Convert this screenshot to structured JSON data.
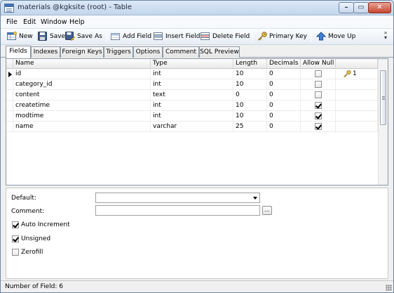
{
  "window": {
    "title": "materials @kgksite (root) - Table",
    "controls": {
      "minimize": "–",
      "maximize": "▭",
      "close": "✕"
    }
  },
  "menu": [
    "File",
    "Edit",
    "Window",
    "Help"
  ],
  "toolbar": {
    "new": "New",
    "save": "Save",
    "save_as": "Save As",
    "add_field": "Add Field",
    "insert_field": "Insert Field",
    "delete_field": "Delete Field",
    "primary_key": "Primary Key",
    "move_up": "Move Up",
    "overflow": "»"
  },
  "tabs": [
    "Fields",
    "Indexes",
    "Foreign Keys",
    "Triggers",
    "Options",
    "Comment",
    "SQL Preview"
  ],
  "active_tab": "Fields",
  "grid": {
    "columns": [
      "Name",
      "Type",
      "Length",
      "Decimals",
      "Allow Null",
      ""
    ],
    "rows": [
      {
        "name": "id",
        "type": "int",
        "length": "10",
        "decimals": "0",
        "allow_null": false,
        "key": "1",
        "current": true
      },
      {
        "name": "category_id",
        "type": "int",
        "length": "10",
        "decimals": "0",
        "allow_null": false,
        "key": "",
        "current": false
      },
      {
        "name": "content",
        "type": "text",
        "length": "0",
        "decimals": "0",
        "allow_null": false,
        "key": "",
        "current": false
      },
      {
        "name": "createtime",
        "type": "int",
        "length": "10",
        "decimals": "0",
        "allow_null": true,
        "key": "",
        "current": false
      },
      {
        "name": "modtime",
        "type": "int",
        "length": "10",
        "decimals": "0",
        "allow_null": true,
        "key": "",
        "current": false
      },
      {
        "name": "name",
        "type": "varchar",
        "length": "25",
        "decimals": "0",
        "allow_null": true,
        "key": "",
        "current": false
      }
    ]
  },
  "properties": {
    "default_label": "Default:",
    "default_value": "",
    "comment_label": "Comment:",
    "comment_value": "",
    "comment_button": "...",
    "auto_increment_label": "Auto Increment",
    "auto_increment": true,
    "unsigned_label": "Unsigned",
    "unsigned": true,
    "zerofill_label": "Zerofill",
    "zerofill": false
  },
  "status": {
    "text": "Number of Field: 6"
  },
  "colors": {
    "accent": "#3f6fb5",
    "close_button": "#c74532"
  }
}
